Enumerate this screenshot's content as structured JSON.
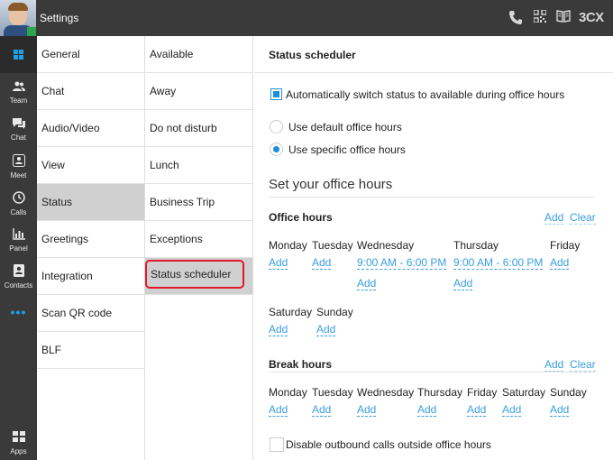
{
  "topbar": {
    "title": "Settings",
    "icons": [
      "phone-icon",
      "qr-code-icon",
      "book-icon"
    ],
    "brand": "3CX"
  },
  "rail": {
    "items": [
      {
        "label": "Team",
        "icon": "team-icon"
      },
      {
        "label": "Chat",
        "icon": "chat-icon"
      },
      {
        "label": "Meet",
        "icon": "meet-icon"
      },
      {
        "label": "Calls",
        "icon": "calls-icon"
      },
      {
        "label": "Panel",
        "icon": "panel-icon"
      },
      {
        "label": "Contacts",
        "icon": "contacts-icon"
      },
      {
        "label": "Apps",
        "icon": "apps-icon"
      }
    ]
  },
  "settings_menu": {
    "items": [
      "General",
      "Chat",
      "Audio/Video",
      "View",
      "Status",
      "Greetings",
      "Integration",
      "Scan QR code",
      "BLF"
    ],
    "active": "Status"
  },
  "status_menu": {
    "items": [
      "Available",
      "Away",
      "Do not disturb",
      "Lunch",
      "Business Trip",
      "Exceptions",
      "Status scheduler"
    ],
    "active": "Status scheduler"
  },
  "main": {
    "header": "Status scheduler",
    "auto_switch_label": "Automatically switch status to available during office hours",
    "radio_default": "Use default office hours",
    "radio_specific": "Use specific office hours",
    "section_title": "Set your office hours",
    "office_hours": {
      "title": "Office hours",
      "add": "Add",
      "clear": "Clear",
      "days": [
        "Monday",
        "Tuesday",
        "Wednesday",
        "Thursday",
        "Friday",
        "Saturday",
        "Sunday"
      ],
      "wednesday_slot": "9:00 AM - 6:00 PM",
      "thursday_slot": "9:00 AM - 6:00 PM",
      "add_label": "Add"
    },
    "break_hours": {
      "title": "Break hours",
      "add": "Add",
      "clear": "Clear",
      "days": [
        "Monday",
        "Tuesday",
        "Wednesday",
        "Thursday",
        "Friday",
        "Saturday",
        "Sunday"
      ],
      "add_label": "Add"
    },
    "disable_outbound_label": "Disable outbound calls outside office hours"
  }
}
